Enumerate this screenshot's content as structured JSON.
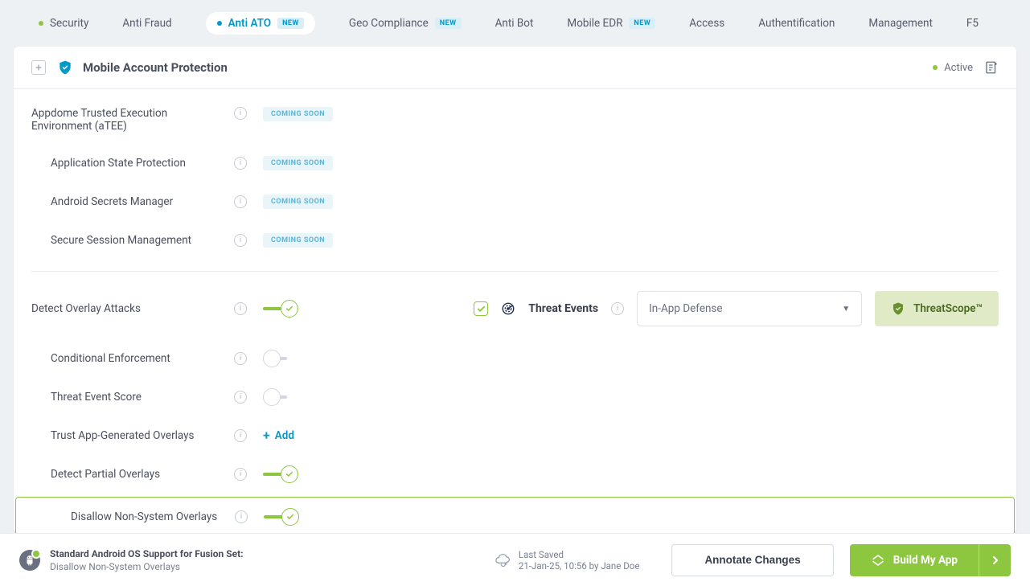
{
  "colors": {
    "accent_green": "#8dc63f",
    "accent_blue": "#0099cc"
  },
  "tabs": [
    {
      "label": "Security",
      "dot": true
    },
    {
      "label": "Anti Fraud"
    },
    {
      "label": "Anti ATO",
      "dot": true,
      "new": true,
      "active": true
    },
    {
      "label": "Geo Compliance",
      "new": true
    },
    {
      "label": "Anti Bot"
    },
    {
      "label": "Mobile EDR",
      "new": true
    },
    {
      "label": "Access"
    },
    {
      "label": "Authentification"
    },
    {
      "label": "Management"
    },
    {
      "label": "F5"
    }
  ],
  "new_label": "NEW",
  "card": {
    "title": "Mobile Account Protection",
    "status": "Active"
  },
  "badges": {
    "coming_soon": "COMING SOON"
  },
  "rows": {
    "atee": "Appdome Trusted Execution Environment (aTEE)",
    "app_state": "Application State Protection",
    "secrets": "Android Secrets Manager",
    "session": "Secure Session Management",
    "overlay": "Detect Overlay Attacks",
    "conditional": "Conditional Enforcement",
    "score": "Threat Event Score",
    "trust_overlays": "Trust App-Generated Overlays",
    "partial": "Detect Partial Overlays",
    "disallow": "Disallow Non-System Overlays"
  },
  "threat": {
    "events_label": "Threat Events",
    "select_value": "In-App Defense",
    "scope_label": "ThreatScope™"
  },
  "add_label": "Add",
  "footer": {
    "title": "Standard Android OS Support for Fusion Set:",
    "subtitle": "Disallow Non-System Overlays",
    "saved_label": "Last Saved",
    "saved_value": "21-Jan-25, 10:56 by Jane Doe",
    "annotate": "Annotate Changes",
    "build": "Build My App"
  }
}
